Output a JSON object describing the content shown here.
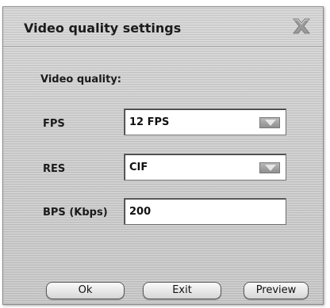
{
  "dialog": {
    "title": "Video quality settings",
    "close_icon": "close-x-icon"
  },
  "section": {
    "label": "Video quality:"
  },
  "fps": {
    "label": "FPS",
    "value": "12 FPS"
  },
  "res": {
    "label": "RES",
    "value": "CIF"
  },
  "bps": {
    "label": "BPS (Kbps)",
    "value": "200"
  },
  "buttons": {
    "ok": "Ok",
    "exit": "Exit",
    "preview": "Preview"
  },
  "colors": {
    "dialog_bg": "#cdcdcd",
    "field_bg": "#ffffff",
    "text": "#1b1b1b"
  }
}
